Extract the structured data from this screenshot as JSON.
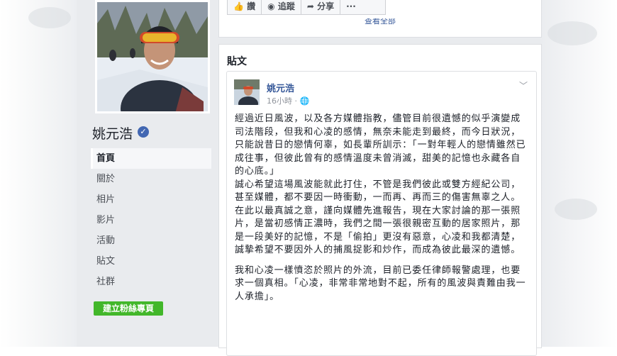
{
  "profile": {
    "name": "姚元浩",
    "verified_icon": "verified-badge-icon"
  },
  "nav": {
    "items": [
      {
        "label": "首頁",
        "active": true
      },
      {
        "label": "關於"
      },
      {
        "label": "相片"
      },
      {
        "label": "影片"
      },
      {
        "label": "活動"
      },
      {
        "label": "貼文"
      },
      {
        "label": "社群"
      }
    ],
    "fan_button": "建立粉絲專頁"
  },
  "actions": {
    "like": "讚",
    "follow": "追蹤",
    "share": "分享",
    "more": "···"
  },
  "top_card": {
    "see_all": "查看全部"
  },
  "posts": {
    "section_title": "貼文",
    "post": {
      "author": "姚元浩",
      "time": "16小時",
      "privacy_icon": "globe-icon",
      "paragraphs": [
        "經過近日風波，以及各方媒體指教，儘管目前很遺憾的似乎演變成司法階段，但我和心凌的感情，無奈未能走到最終，而今日狀況，只能說昔日的戀情何辜，如長輩所訓示：「一對年輕人的戀情雖然已成往事，但彼此曾有的感情溫度未曾消滅，甜美的記憶也永藏各自的心底。」",
        "誠心希望這場風波能就此打住，不管是我們彼此或雙方經紀公司，甚至媒體，都不要因一時衝動，一而再、再而三的傷害無辜之人。",
        "在此以最真誠之意，謹向媒體先進報告，現在大家討論的那一張照片，是當初感情正濃時，我們之間一張很親密互動的居家照片，那是一段美好的記憶，不是「偷拍」更沒有惡意，心凌和我都清楚，誠摯希望不要因外人的捕風捉影和炒作，而成為彼此最深的遺憾。",
        "我和心凌一樣憤恣於照片的外流，目前已委任律師報警處理，也要求一個真相。「心凌，非常非常地對不起，所有的風波與責難由我一人承擔」。"
      ]
    }
  }
}
